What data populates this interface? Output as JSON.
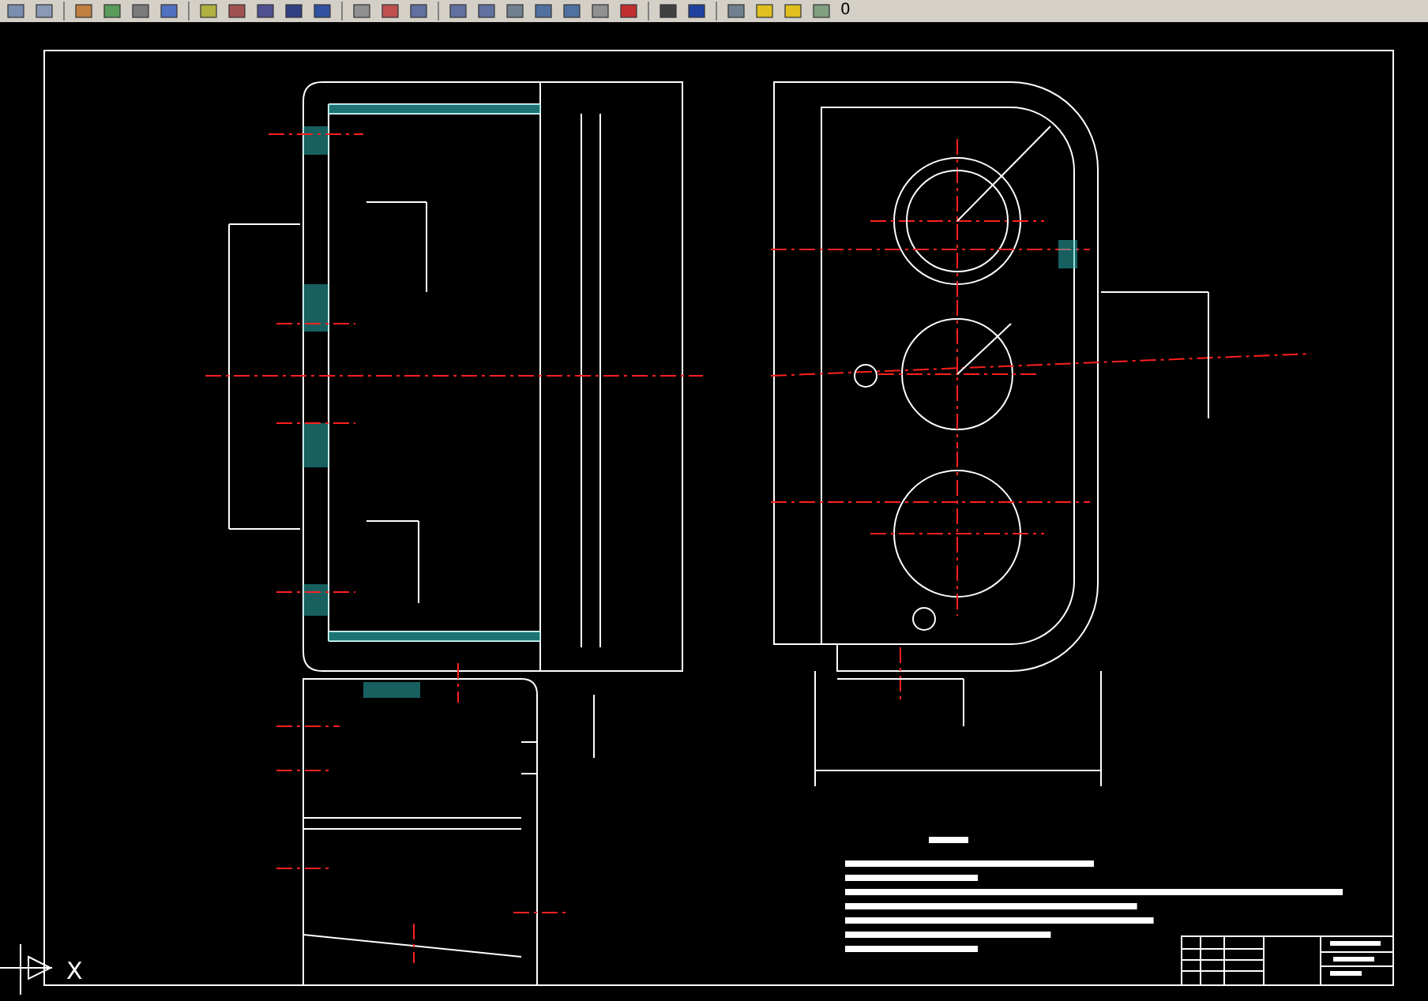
{
  "toolbar": {
    "layer": "0"
  },
  "drawing": {
    "ucs_axis_label": "X"
  }
}
